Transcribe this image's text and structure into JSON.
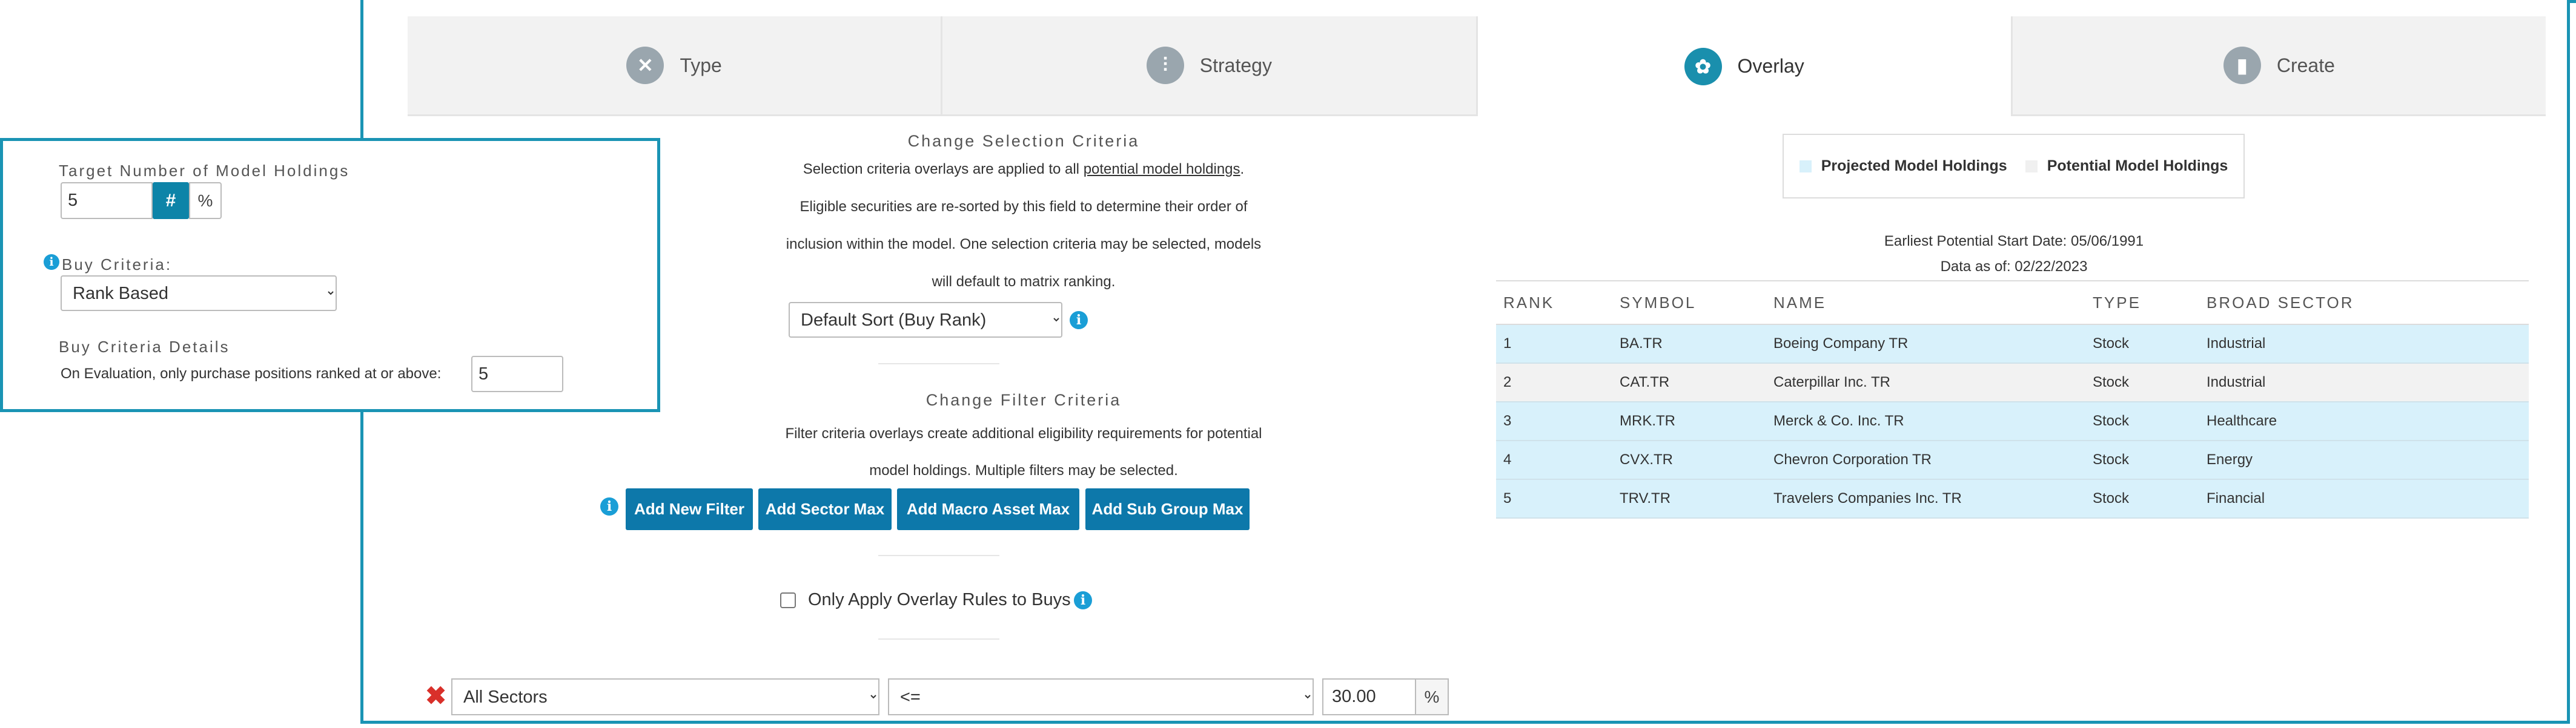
{
  "tabs": [
    {
      "label": "Type",
      "icon": "wrench-icon",
      "active": false
    },
    {
      "label": "Strategy",
      "icon": "sliders-icon",
      "active": false
    },
    {
      "label": "Overlay",
      "icon": "overlay-icon",
      "active": true
    },
    {
      "label": "Create",
      "icon": "bar-chart-icon",
      "active": false
    }
  ],
  "selection": {
    "heading": "Change Selection Criteria",
    "line1_prefix": "Selection criteria overlays are applied to all ",
    "line1_link": "potential model holdings",
    "line1_suffix": ".",
    "line2": "Eligible securities are re-sorted by this field to determine their order of",
    "line3": "inclusion within the model. One selection criteria may be selected, models",
    "line4": "will default to matrix ranking.",
    "sort_value": "Default Sort (Buy Rank)"
  },
  "filter": {
    "heading": "Change Filter Criteria",
    "line1": "Filter criteria overlays create additional eligibility requirements for potential",
    "line2": "model holdings. Multiple filters may be selected.",
    "buttons": [
      "Add New Filter",
      "Add Sector Max",
      "Add Macro Asset Max",
      "Add Sub Group Max"
    ],
    "only_buys_label": "Only Apply Overlay Rules to Buys"
  },
  "filter_row": {
    "sector": "All Sectors",
    "operator": "<=",
    "value": "30.00",
    "unit": "%"
  },
  "legend": {
    "projected": "Projected Model Holdings",
    "potential": "Potential Model Holdings",
    "projected_color": "#d8f1fb",
    "potential_color": "#f0f0f0"
  },
  "info": {
    "start_date": "Earliest Potential Start Date: 05/06/1991",
    "data_as_of": "Data as of: 02/22/2023"
  },
  "holdings": {
    "headers": [
      "RANK",
      "SYMBOL",
      "NAME",
      "TYPE",
      "BROAD SECTOR"
    ],
    "rows": [
      {
        "rank": "1",
        "symbol": "BA.TR",
        "name": "Boeing Company TR",
        "type": "Stock",
        "sector": "Industrial"
      },
      {
        "rank": "2",
        "symbol": "CAT.TR",
        "name": "Caterpillar Inc. TR",
        "type": "Stock",
        "sector": "Industrial"
      },
      {
        "rank": "3",
        "symbol": "MRK.TR",
        "name": "Merck & Co. Inc. TR",
        "type": "Stock",
        "sector": "Healthcare"
      },
      {
        "rank": "4",
        "symbol": "CVX.TR",
        "name": "Chevron Corporation TR",
        "type": "Stock",
        "sector": "Energy"
      },
      {
        "rank": "5",
        "symbol": "TRV.TR",
        "name": "Travelers Companies Inc. TR",
        "type": "Stock",
        "sector": "Financial"
      }
    ]
  },
  "zoom": {
    "target_label": "Target Number of Model Holdings",
    "target_value": "5",
    "hash": "#",
    "pct": "%",
    "buy_criteria_label": "Buy Criteria:",
    "buy_criteria_value": "Rank Based",
    "details_label": "Buy Criteria Details",
    "details_text": "On Evaluation, only purchase positions ranked at or above:",
    "details_value": "5"
  }
}
